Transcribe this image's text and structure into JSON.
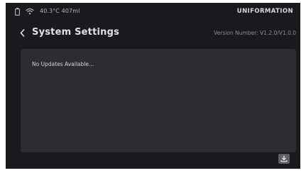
{
  "status_bar": {
    "temp_volume": "40.3°C 407ml",
    "brand": "UNIFORMATION",
    "icons": [
      "battery-icon",
      "wifi-icon"
    ]
  },
  "header": {
    "title": "System Settings",
    "version": "Version Number: V1.2.0/V1.0.0",
    "back_icon": "chevron-left-icon"
  },
  "panel": {
    "message": "No Updates Available..."
  },
  "footer": {
    "download_icon": "download-icon"
  },
  "colors": {
    "background": "#191a1e",
    "panel": "#2c2d33",
    "text": "#e2e2e6",
    "muted": "#8c8c92"
  }
}
